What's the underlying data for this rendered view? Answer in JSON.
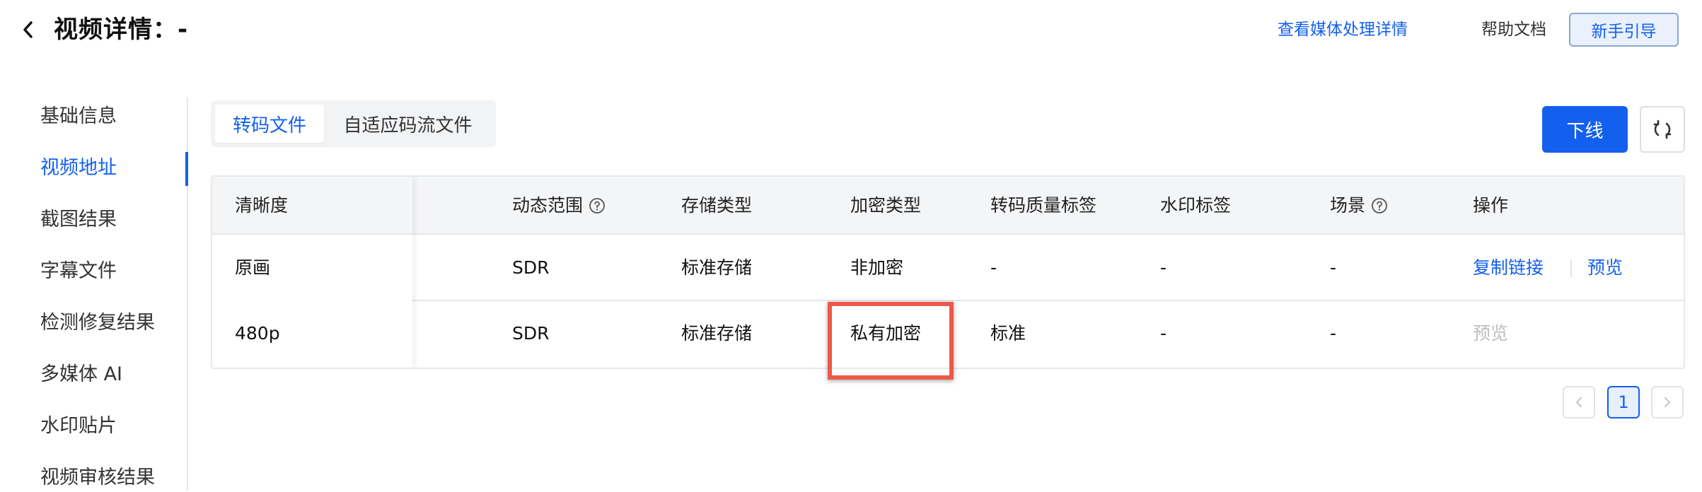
{
  "header": {
    "title": "视频详情：-",
    "media_link": "查看媒体处理详情",
    "help": "帮助文档",
    "guide": "新手引导"
  },
  "sidebar": {
    "items": [
      {
        "label": "基础信息",
        "active": false
      },
      {
        "label": "视频地址",
        "active": true
      },
      {
        "label": "截图结果",
        "active": false
      },
      {
        "label": "字幕文件",
        "active": false
      },
      {
        "label": "检测修复结果",
        "active": false
      },
      {
        "label": "多媒体 AI",
        "active": false
      },
      {
        "label": "水印贴片",
        "active": false
      },
      {
        "label": "视频审核结果",
        "active": false
      }
    ]
  },
  "tabs": [
    {
      "label": "转码文件",
      "active": true
    },
    {
      "label": "自适应码流文件",
      "active": false
    }
  ],
  "actions": {
    "offline": "下线",
    "refresh_icon": "refresh-icon"
  },
  "table": {
    "columns": [
      "清晰度",
      "动态范围",
      "存储类型",
      "加密类型",
      "转码质量标签",
      "水印标签",
      "场景",
      "操作"
    ],
    "help_icon_columns": [
      "动态范围",
      "场景"
    ],
    "rows": [
      {
        "resolution": "原画",
        "dynamic_range": "SDR",
        "storage": "标准存储",
        "encryption": "非加密",
        "quality_tag": "-",
        "watermark": "-",
        "scene": "-",
        "ops": [
          "复制链接",
          "预览"
        ],
        "ops_enabled": true
      },
      {
        "resolution": "480p",
        "dynamic_range": "SDR",
        "storage": "标准存储",
        "encryption": "私有加密",
        "quality_tag": "标准",
        "watermark": "-",
        "scene": "-",
        "ops": [
          "预览"
        ],
        "ops_enabled": false
      }
    ]
  },
  "pagination": {
    "current": "1"
  },
  "colors": {
    "accent": "#1460ee",
    "highlight": "#ee5848"
  }
}
